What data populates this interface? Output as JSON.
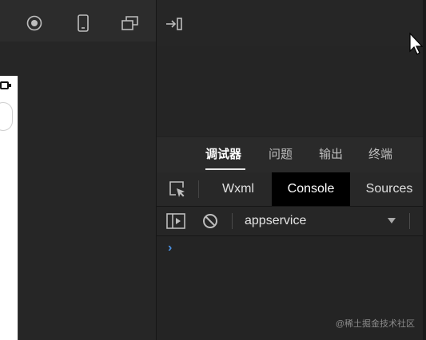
{
  "simulator_toolbar": {
    "icons": [
      "stop-circle-icon",
      "phone-icon",
      "window-icon"
    ]
  },
  "right_toolbar": {
    "icons": [
      "dock-right-icon"
    ]
  },
  "debugger_tabs": [
    {
      "label": "调试器",
      "active": true
    },
    {
      "label": "问题",
      "active": false
    },
    {
      "label": "输出",
      "active": false
    },
    {
      "label": "终端",
      "active": false
    }
  ],
  "devtools_tabs": [
    {
      "label": "Wxml",
      "active": false
    },
    {
      "label": "Console",
      "active": true
    },
    {
      "label": "Sources",
      "active": false
    }
  ],
  "console_toolbar": {
    "context": "appservice"
  },
  "console": {
    "prompt": "›"
  },
  "watermark": "@稀土掘金技术社区",
  "colors": {
    "background": "#232323",
    "prompt": "#4a90e2",
    "active_tab": "#000000"
  }
}
